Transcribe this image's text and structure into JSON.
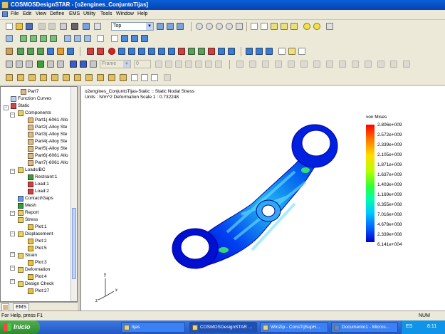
{
  "window": {
    "title": "COSMOSDesignSTAR - [o2engines_ConjuntoTijas]"
  },
  "menu": [
    "File",
    "Edit",
    "View",
    "Define",
    "EMS",
    "Utility",
    "Tools",
    "Window",
    "Help"
  ],
  "toolbar": {
    "view_orientation": "Top",
    "frame_label": "Frame",
    "frame_value": "0"
  },
  "tree": {
    "items": [
      {
        "label": "Part7",
        "icon": "part-icon"
      },
      {
        "label": "Function Curves",
        "icon": "function-curves-icon"
      },
      {
        "label": "Static",
        "icon": "static-study-icon"
      },
      {
        "label": "Components",
        "icon": "folder-icon"
      },
      {
        "label": "Part1(-6061 Allo",
        "icon": "part-icon"
      },
      {
        "label": "Part2(-Alloy Ste",
        "icon": "part-icon"
      },
      {
        "label": "Part3(-Alloy Ste",
        "icon": "part-icon"
      },
      {
        "label": "Part4(-Alloy Ste",
        "icon": "part-icon"
      },
      {
        "label": "Part5(-Alloy Ste",
        "icon": "part-icon"
      },
      {
        "label": "Part6(-6061 Allo",
        "icon": "part-icon"
      },
      {
        "label": "Part7(-6061 Allo",
        "icon": "part-icon"
      },
      {
        "label": "Loads/BC",
        "icon": "loads-folder-icon"
      },
      {
        "label": "Restraint:1",
        "icon": "restraint-icon"
      },
      {
        "label": "Load:1",
        "icon": "load-icon"
      },
      {
        "label": "Load:2",
        "icon": "load-icon"
      },
      {
        "label": "Contact/Gaps",
        "icon": "contact-icon"
      },
      {
        "label": "Mesh",
        "icon": "mesh-icon"
      },
      {
        "label": "Report",
        "icon": "folder-icon"
      },
      {
        "label": "Stress",
        "icon": "folder-icon"
      },
      {
        "label": "Plot:1",
        "icon": "plot-icon"
      },
      {
        "label": "Displacement",
        "icon": "folder-icon"
      },
      {
        "label": "Plot:2",
        "icon": "plot-icon"
      },
      {
        "label": "Plot:5",
        "icon": "plot-icon"
      },
      {
        "label": "Strain",
        "icon": "folder-icon"
      },
      {
        "label": "Plot:3",
        "icon": "plot-icon"
      },
      {
        "label": "Deformation",
        "icon": "folder-icon"
      },
      {
        "label": "Plot:4",
        "icon": "plot-icon"
      },
      {
        "label": "Design Check",
        "icon": "folder-icon"
      },
      {
        "label": "Plot:27",
        "icon": "plot-icon"
      }
    ]
  },
  "tabs": {
    "ems": "EMS"
  },
  "view": {
    "line1": "o2engines_ConjuntoTijas-Static :: Static Nodal Stress",
    "line2": "Units : N/m^2   Deformation Scale   1 : 0.732248"
  },
  "legend": {
    "title": "von Mises",
    "values": [
      "2.806e+009",
      "2.572e+009",
      "2.339e+009",
      "2.105e+009",
      "1.871e+009",
      "1.637e+009",
      "1.403e+009",
      "1.169e+009",
      "9.355e+008",
      "7.016e+008",
      "4.678e+008",
      "2.339e+008",
      "6.141e+004"
    ]
  },
  "axes": {
    "x": "x",
    "y": "y",
    "z": "z"
  },
  "status": {
    "help": "For Help, press F1",
    "num": "NUM"
  },
  "taskbar": {
    "start": "Inicio",
    "buttons": [
      "tijas",
      "COSMOSDesignSTAR ...",
      "WinZip - ConsTijSupH...",
      "Documento1 - Micros..."
    ],
    "lang": "ES",
    "clock": "8:11"
  },
  "colors": {
    "titlebar": "#0a5fd8",
    "stress_low": "#0000cc",
    "stress_mid": "#33ff33",
    "stress_high": "#ff0000"
  }
}
